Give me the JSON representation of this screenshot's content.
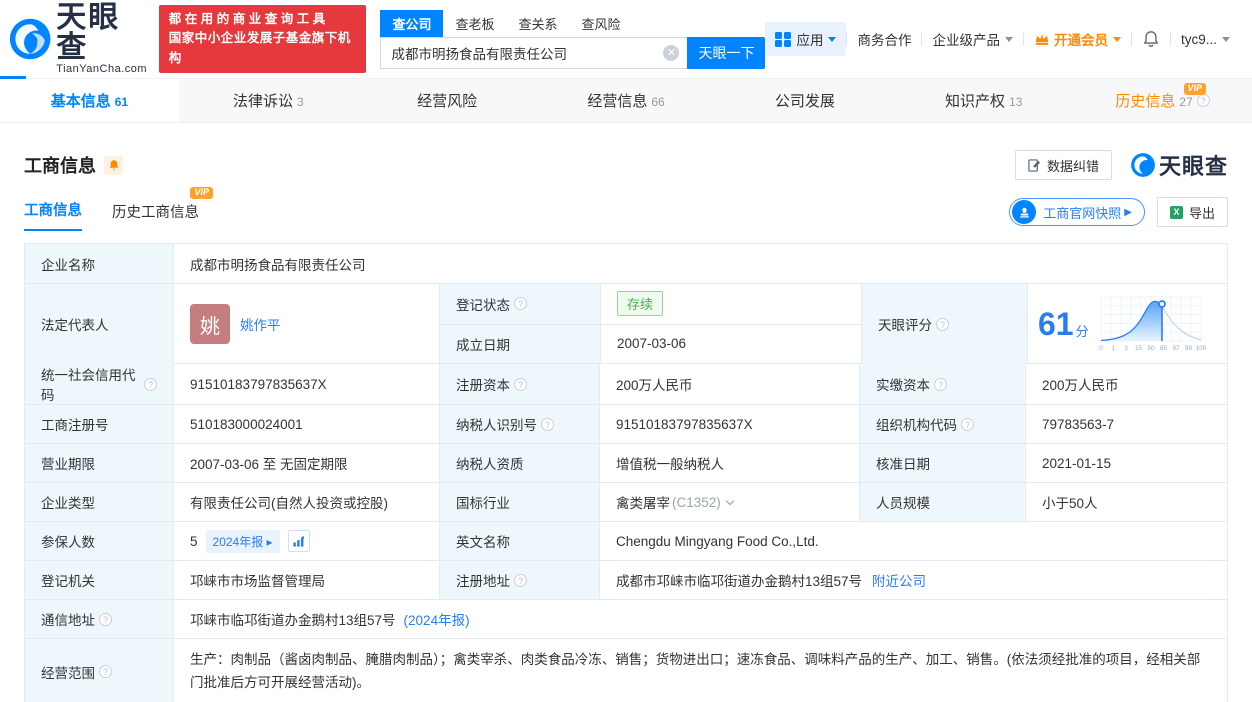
{
  "theme": {
    "primary": "#0084ff",
    "link": "#2a7df0",
    "orange": "#ff8a00",
    "red": "#e6393d",
    "green": "#4fae4f",
    "label_bg": "#eef7fc",
    "border": "#e4eaf1",
    "avatar_bg": "#c57e80"
  },
  "header": {
    "logo": {
      "title": "天眼查",
      "domain": "TianYanCha.com"
    },
    "slogan_line1": "都在用的商业查询工具",
    "slogan_line2": "国家中小企业发展子基金旗下机构",
    "search_tabs": [
      {
        "label": "查公司"
      },
      {
        "label": "查老板"
      },
      {
        "label": "查关系"
      },
      {
        "label": "查风险"
      }
    ],
    "search": {
      "value": "成都市明扬食品有限责任公司",
      "button": "天眼一下"
    },
    "menu": {
      "apps": "应用",
      "coop": "商务合作",
      "enterprise": "企业级产品",
      "vip": "开通会员",
      "user": "tyc9..."
    }
  },
  "navbar": {
    "tabs": [
      {
        "label": "基本信息",
        "count": "61"
      },
      {
        "label": "法律诉讼",
        "count": "3"
      },
      {
        "label": "经营风险",
        "count": ""
      },
      {
        "label": "经营信息",
        "count": "66"
      },
      {
        "label": "公司发展",
        "count": ""
      },
      {
        "label": "知识产权",
        "count": "13"
      },
      {
        "label": "历史信息",
        "count": "27",
        "vip": "VIP"
      }
    ]
  },
  "section": {
    "title": "工商信息",
    "tabs": [
      {
        "label": "工商信息"
      },
      {
        "label": "历史工商信息",
        "vip": "VIP"
      }
    ],
    "actions": {
      "correct": "数据纠错",
      "snapshot": "工商官网快照",
      "export": "导出"
    },
    "brand": "天眼查"
  },
  "table": {
    "company_name": {
      "label": "企业名称",
      "value": "成都市明扬食品有限责任公司"
    },
    "legal_rep": {
      "label": "法定代表人",
      "avatar": "姚",
      "name": "姚作平"
    },
    "reg_status": {
      "label": "登记状态",
      "value": "存续"
    },
    "establish_date": {
      "label": "成立日期",
      "value": "2007-03-06"
    },
    "score": {
      "label": "天眼评分",
      "value": "61",
      "unit": "分"
    },
    "grid_rows": [
      [
        {
          "label": "统一社会信用代码",
          "value": "91510183797835637X"
        },
        {
          "label": "注册资本",
          "value": "200万人民币"
        },
        {
          "label": "实缴资本",
          "value": "200万人民币"
        }
      ],
      [
        {
          "label": "工商注册号",
          "value": "510183000024001"
        },
        {
          "label": "纳税人识别号",
          "value": "91510183797835637X"
        },
        {
          "label": "组织机构代码",
          "value": "79783563-7"
        }
      ],
      [
        {
          "label": "营业期限",
          "value": "2007-03-06 至 无固定期限"
        },
        {
          "label": "纳税人资质",
          "value": "增值税一般纳税人"
        },
        {
          "label": "核准日期",
          "value": "2021-01-15"
        }
      ]
    ],
    "company_type": {
      "label": "企业类型",
      "value": "有限责任公司(自然人投资或控股)"
    },
    "industry": {
      "label": "国标行业",
      "value": "禽类屠宰",
      "code": "(C1352)"
    },
    "staff_size": {
      "label": "人员规模",
      "value": "小于50人"
    },
    "insured": {
      "label": "参保人数",
      "value": "5",
      "badge": "2024年报"
    },
    "english_name": {
      "label": "英文名称",
      "value": "Chengdu Mingyang Food Co.,Ltd."
    },
    "reg_authority": {
      "label": "登记机关",
      "value": "邛崃市市场监督管理局"
    },
    "reg_address": {
      "label": "注册地址",
      "value": "成都市邛崃市临邛街道办金鹅村13组57号",
      "link": "附近公司"
    },
    "mail_address": {
      "label": "通信地址",
      "value": "邛崃市临邛街道办金鹅村13组57号",
      "link": "(2024年报)"
    },
    "business_scope": {
      "label": "经营范围",
      "value": "生产：肉制品（酱卤肉制品、腌腊肉制品）；禽类宰杀、肉类食品冷冻、销售；货物进出口；速冻食品、调味料产品的生产、加工、销售。(依法须经批准的项目，经相关部门批准后方可开展经营活动)。"
    }
  },
  "chart_data": {
    "type": "line",
    "title": "天眼评分分布曲线",
    "score": 61,
    "x_ticks": [
      "0",
      "1",
      "3",
      "15",
      "50",
      "85",
      "97",
      "99",
      "100"
    ],
    "marker_position_percent": 61,
    "legend_position": "none",
    "grid": true,
    "description": "正态分布曲线，标记点位于50与85刻度之间，左侧区域蓝色渐变填充"
  }
}
